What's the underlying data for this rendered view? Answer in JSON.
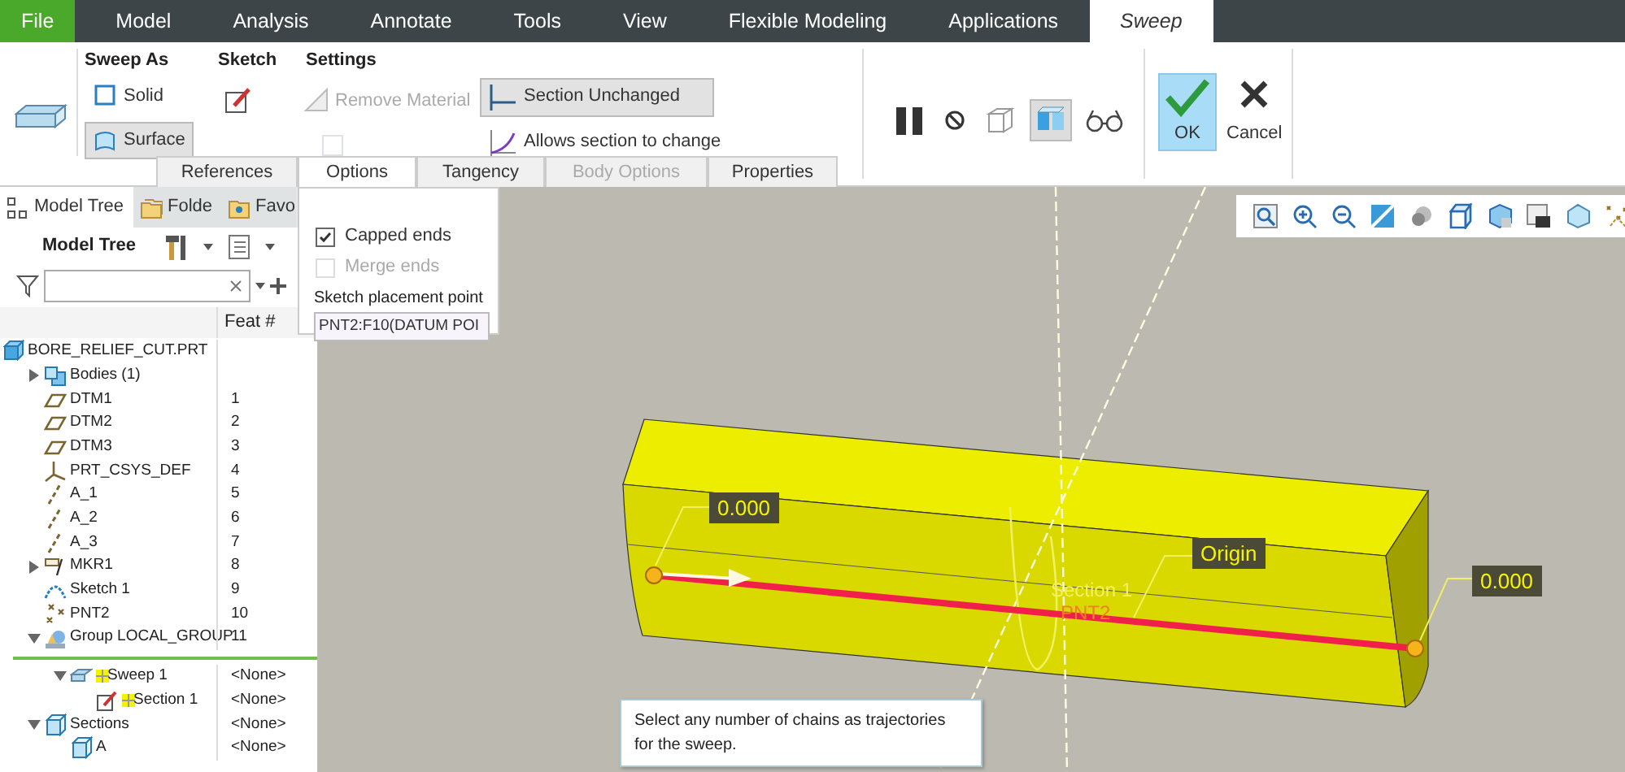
{
  "menu_tabs": [
    {
      "kind": "file",
      "label": "File",
      "selected": false
    },
    {
      "kind": "tab",
      "label": "Model",
      "selected": false
    },
    {
      "kind": "tab",
      "label": "Analysis",
      "selected": false
    },
    {
      "kind": "tab",
      "label": "Annotate",
      "selected": false
    },
    {
      "kind": "tab",
      "label": "Tools",
      "selected": false
    },
    {
      "kind": "tab",
      "label": "View",
      "selected": false
    },
    {
      "kind": "tab",
      "label": "Flexible Modeling",
      "selected": false
    },
    {
      "kind": "tab",
      "label": "Applications",
      "selected": false
    },
    {
      "kind": "tab",
      "label": "Sweep",
      "selected": true
    }
  ],
  "ribbon": {
    "sweep_as": {
      "title": "Sweep As",
      "options": [
        {
          "label": "Solid",
          "selected": false
        },
        {
          "label": "Surface",
          "selected": true
        }
      ]
    },
    "sketch": {
      "title": "Sketch"
    },
    "settings": {
      "title": "Settings",
      "remove_material": {
        "label": "Remove Material",
        "disabled": true
      },
      "thicken": {
        "checked": false
      },
      "section_modes": [
        {
          "label": "Section Unchanged",
          "selected": true
        },
        {
          "label": "Allows section to change",
          "selected": false
        }
      ]
    },
    "tools": [
      {
        "kind": "pause",
        "selected": false
      },
      {
        "kind": "no-entry",
        "selected": false
      },
      {
        "kind": "wire",
        "selected": false
      },
      {
        "kind": "preview",
        "selected": true
      },
      {
        "kind": "glasses",
        "selected": false
      }
    ],
    "actions": [
      {
        "kind": "ok",
        "label": "OK",
        "selected": true
      },
      {
        "kind": "cancel",
        "label": "Cancel",
        "selected": false
      }
    ]
  },
  "sub_tabs": [
    {
      "label": "References",
      "selected": false,
      "disabled": false
    },
    {
      "label": "Options",
      "selected": true,
      "disabled": false
    },
    {
      "label": "Tangency",
      "selected": false,
      "disabled": false
    },
    {
      "label": "Body Options",
      "selected": false,
      "disabled": true
    },
    {
      "label": "Properties",
      "selected": false,
      "disabled": false
    }
  ],
  "options_panel": {
    "items": [
      {
        "label": "Capped ends",
        "checked": true,
        "disabled": false
      },
      {
        "label": "Merge ends",
        "checked": false,
        "disabled": true
      }
    ],
    "placement": {
      "label": "Sketch placement point",
      "value": "PNT2:F10(DATUM POI"
    }
  },
  "side_tabs": [
    {
      "kind": "tree",
      "label": "Model Tree",
      "selected": true
    },
    {
      "kind": "folder",
      "label": "Folde",
      "selected": false
    },
    {
      "kind": "favorites",
      "label": "Favo",
      "selected": false
    }
  ],
  "tree": {
    "title": "Model Tree",
    "columns": [
      "Feat #"
    ],
    "root": {
      "kind": "part",
      "label": "BORE_RELIEF_CUT.PRT",
      "children": [
        {
          "kind": "bodies",
          "label": "Bodies (1)",
          "expanded": false,
          "new": false
        },
        {
          "kind": "plane",
          "label": "DTM1",
          "feat": "1",
          "new": false
        },
        {
          "kind": "plane",
          "label": "DTM2",
          "feat": "2",
          "new": false
        },
        {
          "kind": "plane",
          "label": "DTM3",
          "feat": "3",
          "new": false
        },
        {
          "kind": "csys",
          "label": "PRT_CSYS_DEF",
          "feat": "4",
          "new": false
        },
        {
          "kind": "axis",
          "label": "A_1",
          "feat": "5",
          "new": false
        },
        {
          "kind": "axis",
          "label": "A_2",
          "feat": "6",
          "new": false
        },
        {
          "kind": "axis",
          "label": "A_3",
          "feat": "7",
          "new": false
        },
        {
          "kind": "marker",
          "label": "MKR1",
          "feat": "8",
          "expanded": false,
          "new": false
        },
        {
          "kind": "sketch",
          "label": "Sketch 1",
          "feat": "9",
          "new": false
        },
        {
          "kind": "point",
          "label": "PNT2",
          "feat": "10",
          "new": false
        },
        {
          "kind": "group",
          "label": "Group LOCAL_GROUP",
          "feat": "11",
          "expanded": true,
          "new": false
        }
      ]
    },
    "inserted": [
      {
        "kind": "sweep",
        "label": "Sweep 1",
        "feat": "<None>",
        "expanded": true,
        "new": true,
        "children": [
          {
            "kind": "section",
            "label": "Section 1",
            "feat": "<None>",
            "new": true
          }
        ]
      }
    ],
    "after": [
      {
        "kind": "sections",
        "label": "Sections",
        "feat": "<None>",
        "expanded": true,
        "new": false,
        "children": [
          {
            "kind": "sections",
            "label": "A",
            "feat": "<None>",
            "new": false
          }
        ]
      }
    ]
  },
  "viewport": {
    "labels": [
      {
        "kind": "dimension",
        "text": "0.000"
      },
      {
        "kind": "dimension-origin",
        "text": "Origin"
      },
      {
        "kind": "dimension-end",
        "text": "0.000"
      },
      {
        "kind": "section",
        "text": "Section 1"
      },
      {
        "kind": "point",
        "text": "PNT2"
      }
    ],
    "tooltip": "Select any number of chains as trajectories for the sweep."
  }
}
